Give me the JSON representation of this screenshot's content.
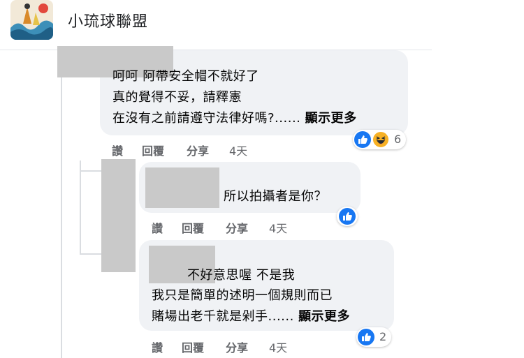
{
  "group": {
    "name": "小琉球聯盟"
  },
  "colors": {
    "like_blue": "#1877f2",
    "haha_yellow": "#f7b125",
    "bubble_bg": "#f0f2f5",
    "meta_gray": "#65676b"
  },
  "comments": [
    {
      "lines": [
        "呵呵 阿帶安全帽不就好了",
        "真的覺得不妥，請釋憲",
        "在沒有之前請遵守法律好嗎?...... "
      ],
      "see_more": "顯示更多",
      "actions": {
        "like": "讚",
        "reply": "回覆",
        "share": "分享",
        "time": "4天"
      },
      "reactions": [
        "like-icon",
        "haha-icon"
      ],
      "reaction_count": "6"
    },
    {
      "lines": [
        "所以拍攝者是你？"
      ],
      "actions": {
        "like": "讚",
        "reply": "回覆",
        "share": "分享",
        "time": "4天"
      },
      "reactions": [
        "like-icon"
      ],
      "reaction_count": ""
    },
    {
      "lines": [
        "不好意思喔 不是我",
        "我只是簡單的述明一個規則而已",
        "賭場出老千就是剁手...... "
      ],
      "see_more": "顯示更多",
      "actions": {
        "like": "讚",
        "reply": "回覆",
        "share": "分享",
        "time": "4天"
      },
      "reactions": [
        "like-icon"
      ],
      "reaction_count": "2"
    }
  ]
}
